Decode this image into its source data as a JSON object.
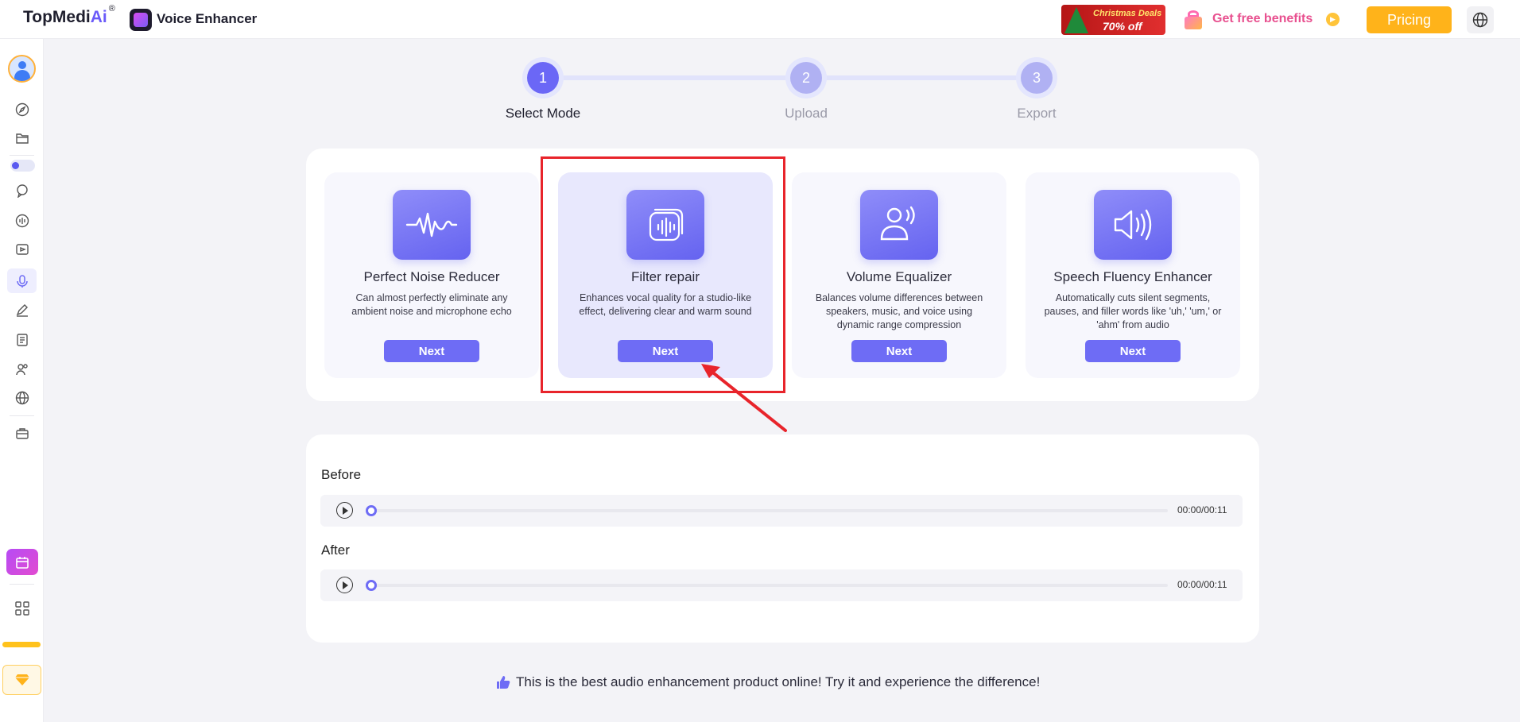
{
  "header": {
    "brand_main": "TopMedi",
    "brand_ai": "Ai",
    "brand_reg": "®",
    "app_name": "Voice Enhancer",
    "promo_line1": "Christmas Deals",
    "promo_line2": "70% off",
    "free_benefits": "Get free benefits",
    "pricing_label": "Pricing",
    "language_icon": "globe-icon"
  },
  "sidebar": {
    "icons": [
      "avatar",
      "compass-icon",
      "folder-icon",
      "toggle-switch",
      "chat-ai-icon",
      "audio-wave-icon",
      "video-ai-icon",
      "microphone-icon",
      "pen-icon",
      "document-icon",
      "people-icon",
      "globe-icon",
      "toolbox-icon",
      "calendar-promo-icon",
      "apps-grid-icon",
      "diamond-icon"
    ],
    "active_item": "microphone-icon"
  },
  "stepper": {
    "steps": [
      {
        "number": "1",
        "label": "Select Mode",
        "active": true
      },
      {
        "number": "2",
        "label": "Upload",
        "active": false
      },
      {
        "number": "3",
        "label": "Export",
        "active": false
      }
    ]
  },
  "modes": [
    {
      "title": "Perfect Noise Reducer",
      "description": "Can almost perfectly eliminate any ambient noise and microphone echo",
      "button": "Next",
      "icon": "noise-wave-icon",
      "selected": false
    },
    {
      "title": "Filter repair",
      "description": "Enhances vocal quality for a studio-like effect, delivering clear and warm sound",
      "button": "Next",
      "icon": "filter-sound-icon",
      "selected": true
    },
    {
      "title": "Volume Equalizer",
      "description": "Balances volume differences between speakers, music, and voice using dynamic range compression",
      "button": "Next",
      "icon": "speaker-person-icon",
      "selected": false
    },
    {
      "title": "Speech Fluency Enhancer",
      "description": "Automatically cuts silent segments, pauses, and filler words like 'uh,' 'um,' or 'ahm' from audio",
      "button": "Next",
      "icon": "speaker-volume-icon",
      "selected": false
    }
  ],
  "comparison": {
    "before_label": "Before",
    "after_label": "After",
    "before_time": "00:00/00:11",
    "after_time": "00:00/00:11"
  },
  "footer": {
    "text": "This is the best audio enhancement product online! Try it and experience the difference!",
    "icon": "thumbs-up-icon"
  },
  "colors": {
    "accent": "#6e6cf5",
    "pricing": "#ffb31a",
    "highlight": "#e8242b",
    "background": "#f3f3f7"
  }
}
